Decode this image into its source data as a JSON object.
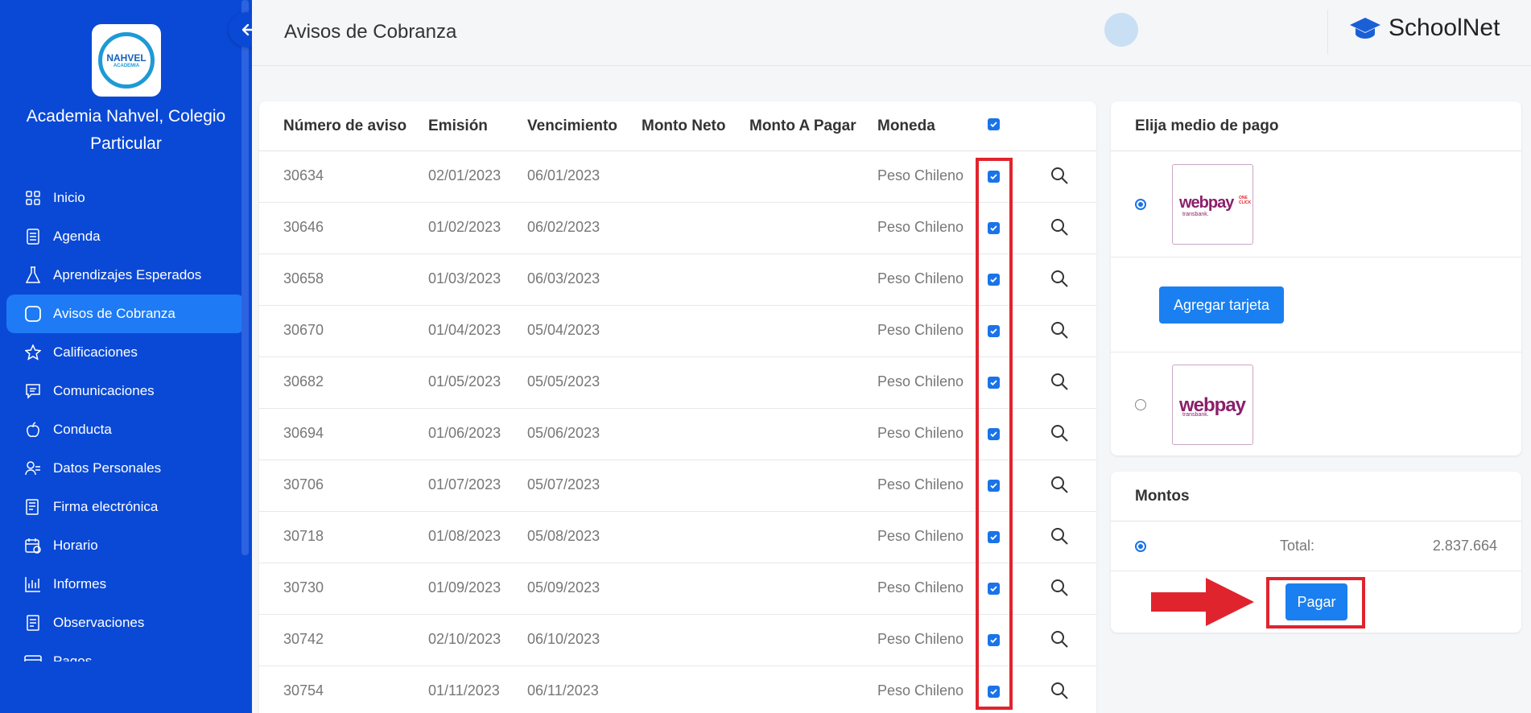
{
  "sidebar": {
    "logo_text": "NAHVEL",
    "logo_sub": "ACADEMIA",
    "school_name": "Academia Nahvel, Colegio Particular",
    "items": [
      {
        "label": "Inicio",
        "icon": "grid-icon"
      },
      {
        "label": "Agenda",
        "icon": "notebook-icon"
      },
      {
        "label": "Aprendizajes Esperados",
        "icon": "flask-icon"
      },
      {
        "label": "Avisos de Cobranza",
        "icon": "square-icon",
        "active": true
      },
      {
        "label": "Calificaciones",
        "icon": "star-icon"
      },
      {
        "label": "Comunicaciones",
        "icon": "message-icon"
      },
      {
        "label": "Conducta",
        "icon": "apple-icon"
      },
      {
        "label": "Datos Personales",
        "icon": "user-icon"
      },
      {
        "label": "Firma electrónica",
        "icon": "document-sign-icon"
      },
      {
        "label": "Horario",
        "icon": "calendar-icon"
      },
      {
        "label": "Informes",
        "icon": "chart-icon"
      },
      {
        "label": "Observaciones",
        "icon": "file-icon"
      },
      {
        "label": "Pagos",
        "icon": "card-icon"
      }
    ]
  },
  "header": {
    "title": "Avisos de Cobranza",
    "brand": "SchoolNet"
  },
  "table": {
    "columns": [
      "Número de aviso",
      "Emisión",
      "Vencimiento",
      "Monto Neto",
      "Monto A Pagar",
      "Moneda"
    ],
    "rows": [
      {
        "numero": "30634",
        "emision": "02/01/2023",
        "vencimiento": "06/01/2023",
        "moneda": "Peso Chileno"
      },
      {
        "numero": "30646",
        "emision": "01/02/2023",
        "vencimiento": "06/02/2023",
        "moneda": "Peso Chileno"
      },
      {
        "numero": "30658",
        "emision": "01/03/2023",
        "vencimiento": "06/03/2023",
        "moneda": "Peso Chileno"
      },
      {
        "numero": "30670",
        "emision": "01/04/2023",
        "vencimiento": "05/04/2023",
        "moneda": "Peso Chileno"
      },
      {
        "numero": "30682",
        "emision": "01/05/2023",
        "vencimiento": "05/05/2023",
        "moneda": "Peso Chileno"
      },
      {
        "numero": "30694",
        "emision": "01/06/2023",
        "vencimiento": "05/06/2023",
        "moneda": "Peso Chileno"
      },
      {
        "numero": "30706",
        "emision": "01/07/2023",
        "vencimiento": "05/07/2023",
        "moneda": "Peso Chileno"
      },
      {
        "numero": "30718",
        "emision": "01/08/2023",
        "vencimiento": "05/08/2023",
        "moneda": "Peso Chileno"
      },
      {
        "numero": "30730",
        "emision": "01/09/2023",
        "vencimiento": "05/09/2023",
        "moneda": "Peso Chileno"
      },
      {
        "numero": "30742",
        "emision": "02/10/2023",
        "vencimiento": "06/10/2023",
        "moneda": "Peso Chileno"
      },
      {
        "numero": "30754",
        "emision": "01/11/2023",
        "vencimiento": "06/11/2023",
        "moneda": "Peso Chileno"
      }
    ]
  },
  "payment": {
    "title": "Elija medio de pago",
    "webpay_oneclick": "webpay",
    "oneclick_tag": "ONE CLICK",
    "transbank": "transbank.",
    "add_card_label": "Agregar tarjeta",
    "webpay": "webpay"
  },
  "montos": {
    "title": "Montos",
    "total_label": "Total:",
    "total_value": "2.837.664",
    "pay_label": "Pagar"
  },
  "colors": {
    "sidebar": "#0a49d6",
    "accent": "#1a7ff0",
    "highlight": "#e0242e",
    "webpay": "#8b1f6b"
  }
}
